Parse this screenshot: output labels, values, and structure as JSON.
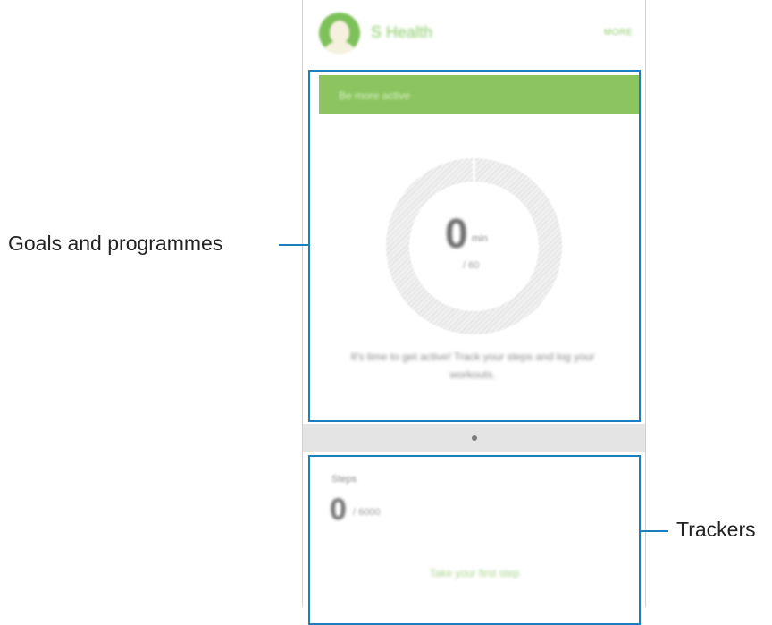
{
  "header": {
    "app_title": "S Health",
    "more_label": "MORE"
  },
  "goals": {
    "card_title": "Be more active",
    "progress_badge": "0%",
    "progress_fraction": 0,
    "value": "0",
    "unit": "min",
    "target": "/ 60",
    "message": "It's time to get active! Track your steps and log your workouts."
  },
  "pager": {
    "page_count": 1,
    "active_index": 0
  },
  "trackers": {
    "steps_label": "Steps",
    "steps_value": "0",
    "steps_target": "/ 6000",
    "first_step_label": "Take your first step"
  },
  "callouts": {
    "goals_label": "Goals and programmes",
    "trackers_label": "Trackers"
  },
  "colors": {
    "accent_green": "#8cc55f",
    "highlight_blue": "#1b7fc2",
    "pager_strip": "#e4e4e4"
  },
  "icons": {
    "avatar": "user-avatar-icon"
  }
}
